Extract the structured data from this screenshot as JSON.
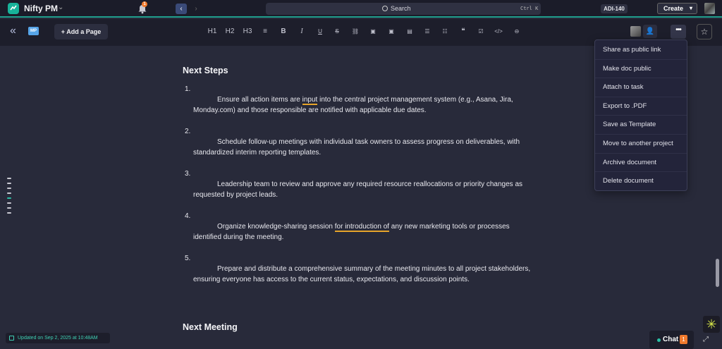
{
  "app": {
    "name": "Nifty PM",
    "notifications": "1"
  },
  "search": {
    "label": "Search",
    "shortcut": "Ctrl K"
  },
  "header": {
    "ticket_id": "ADI-140",
    "create_label": "Create"
  },
  "toolbar": {
    "project_badge": "MP",
    "add_page_label": "+ Add a Page",
    "format_buttons": [
      "H1",
      "H2",
      "H3",
      "≡",
      "B",
      "I",
      "U",
      "S",
      "⛓",
      "▣",
      "▣",
      "▤",
      "☰",
      "☷",
      "❝",
      "☑",
      "</>",
      "⊖"
    ]
  },
  "doc": {
    "section1_title": "Next Steps",
    "items": [
      {
        "num": "1.",
        "pre": "Ensure all action items are ",
        "hl": "input",
        "post": " into the central project management system (e.g., Asana, Jira, Monday.com) and those responsible are notified with applicable due dates."
      },
      {
        "num": "2.",
        "text": "Schedule follow-up meetings with individual task owners to assess progress on deliverables, with standardized interim reporting templates."
      },
      {
        "num": "3.",
        "text": "Leadership team to review and approve any required resource reallocations or priority changes as requested by project leads."
      },
      {
        "num": "4.",
        "pre": "Organize knowledge-sharing session ",
        "hl": "for introduction of",
        "post": " any new marketing tools or processes identified during the meeting."
      },
      {
        "num": "5.",
        "text": "Prepare and distribute a comprehensive summary of the meeting minutes to all project stakeholders, ensuring everyone has access to the current status, expectations, and discussion points."
      }
    ],
    "section2_title": "Next Meeting"
  },
  "menu": {
    "items": [
      "Share as public link",
      "Make doc public",
      "Attach to task",
      "Export to .PDF",
      "Save as Template",
      "Move to another project",
      "Archive document",
      "Delete document"
    ]
  },
  "footer": {
    "updated_text": "Updated on Sep 2, 2025 at 10:48AM",
    "chat_label": "Chat",
    "chat_badge": "1"
  },
  "colors": {
    "accent": "#1f9e8c",
    "highlight": "#e7a52a",
    "badge": "#f07a2d",
    "background": "#282a3a"
  }
}
